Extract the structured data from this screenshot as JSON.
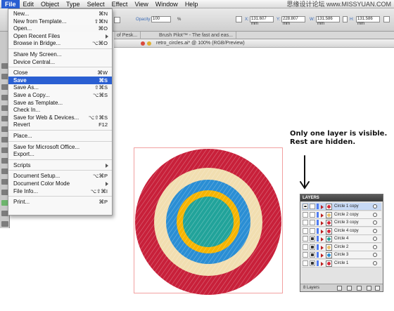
{
  "menubar": {
    "items": [
      "File",
      "Edit",
      "Object",
      "Type",
      "Select",
      "Effect",
      "View",
      "Window",
      "Help"
    ],
    "active_index": 0
  },
  "watermark": "思缘设计论坛  www.MISSYUAN.COM",
  "controlbar": {
    "opacity_label": "Opacity:",
    "opacity_value": "100",
    "opacity_unit": "%",
    "x_label": "X:",
    "x_value": "131.607 mm",
    "y_label": "Y:",
    "y_value": "228.807 mm",
    "w_label": "W:",
    "w_value": "131.586 mm",
    "h_label": "H:",
    "h_value": "131.586 mm"
  },
  "tabs": [
    "of Pesk...",
    "Brush Pilot™ - The fast and eas..."
  ],
  "document": {
    "title": "retro_circles.ai* @ 100% (RGB/Preview)"
  },
  "file_menu": {
    "items": [
      {
        "label": "New...",
        "shortcut": "⌘N"
      },
      {
        "label": "New from Template...",
        "shortcut": "⇧⌘N"
      },
      {
        "label": "Open...",
        "shortcut": "⌘O"
      },
      {
        "label": "Open Recent Files",
        "shortcut": "",
        "submenu": true
      },
      {
        "label": "Browse in Bridge...",
        "shortcut": "⌥⌘O"
      },
      {
        "separator": true
      },
      {
        "label": "Share My Screen...",
        "shortcut": ""
      },
      {
        "label": "Device Central...",
        "shortcut": ""
      },
      {
        "separator": true
      },
      {
        "label": "Close",
        "shortcut": "⌘W"
      },
      {
        "label": "Save",
        "shortcut": "⌘S",
        "highlighted": true
      },
      {
        "label": "Save As...",
        "shortcut": "⇧⌘S"
      },
      {
        "label": "Save a Copy...",
        "shortcut": "⌥⌘S"
      },
      {
        "label": "Save as Template...",
        "shortcut": ""
      },
      {
        "label": "Check In...",
        "shortcut": ""
      },
      {
        "label": "Save for Web & Devices...",
        "shortcut": "⌥⇧⌘S"
      },
      {
        "label": "Revert",
        "shortcut": "F12"
      },
      {
        "separator": true
      },
      {
        "label": "Place...",
        "shortcut": ""
      },
      {
        "separator": true
      },
      {
        "label": "Save for Microsoft Office...",
        "shortcut": ""
      },
      {
        "label": "Export...",
        "shortcut": ""
      },
      {
        "separator": true
      },
      {
        "label": "Scripts",
        "shortcut": "",
        "submenu": true
      },
      {
        "separator": true
      },
      {
        "label": "Document Setup...",
        "shortcut": "⌥⌘P"
      },
      {
        "label": "Document Color Mode",
        "shortcut": "",
        "submenu": true
      },
      {
        "label": "File Info...",
        "shortcut": "⌥⇧⌘I"
      },
      {
        "separator": true
      },
      {
        "label": "Print...",
        "shortcut": "⌘P"
      }
    ]
  },
  "annotation": {
    "line1": "Only one layer is visible.",
    "line2": "Rest are hidden."
  },
  "layers_panel": {
    "title": "LAYERS",
    "count_label": "8 Layers",
    "layers": [
      {
        "name": "Circle 1 copy",
        "visible": true,
        "locked": false,
        "selected": true,
        "thumb_color": "#d62a3a"
      },
      {
        "name": "Circle 2 copy",
        "visible": false,
        "locked": false,
        "selected": false,
        "thumb_color": "#e8c06a"
      },
      {
        "name": "Circle 3 copy",
        "visible": false,
        "locked": false,
        "selected": false,
        "thumb_color": "#d62a3a"
      },
      {
        "name": "Circle 4 copy",
        "visible": false,
        "locked": false,
        "selected": false,
        "thumb_color": "#d62a3a"
      },
      {
        "name": "Circle 4",
        "visible": false,
        "locked": true,
        "selected": false,
        "thumb_color": "#26a69a"
      },
      {
        "name": "Circle 2",
        "visible": false,
        "locked": true,
        "selected": false,
        "thumb_color": "#e8c06a"
      },
      {
        "name": "Circle 3",
        "visible": false,
        "locked": true,
        "selected": false,
        "thumb_color": "#2a8ed4"
      },
      {
        "name": "Circle 1",
        "visible": false,
        "locked": true,
        "selected": false,
        "thumb_color": "#d62a3a"
      }
    ]
  },
  "colors": {
    "menu_highlight": "#2a5fd2",
    "ring_red": "#c8203a",
    "ring_cream": "#f1deb0",
    "ring_blue": "#2a8ed4",
    "ring_yellow": "#f5b400",
    "ring_teal": "#21a39a"
  }
}
